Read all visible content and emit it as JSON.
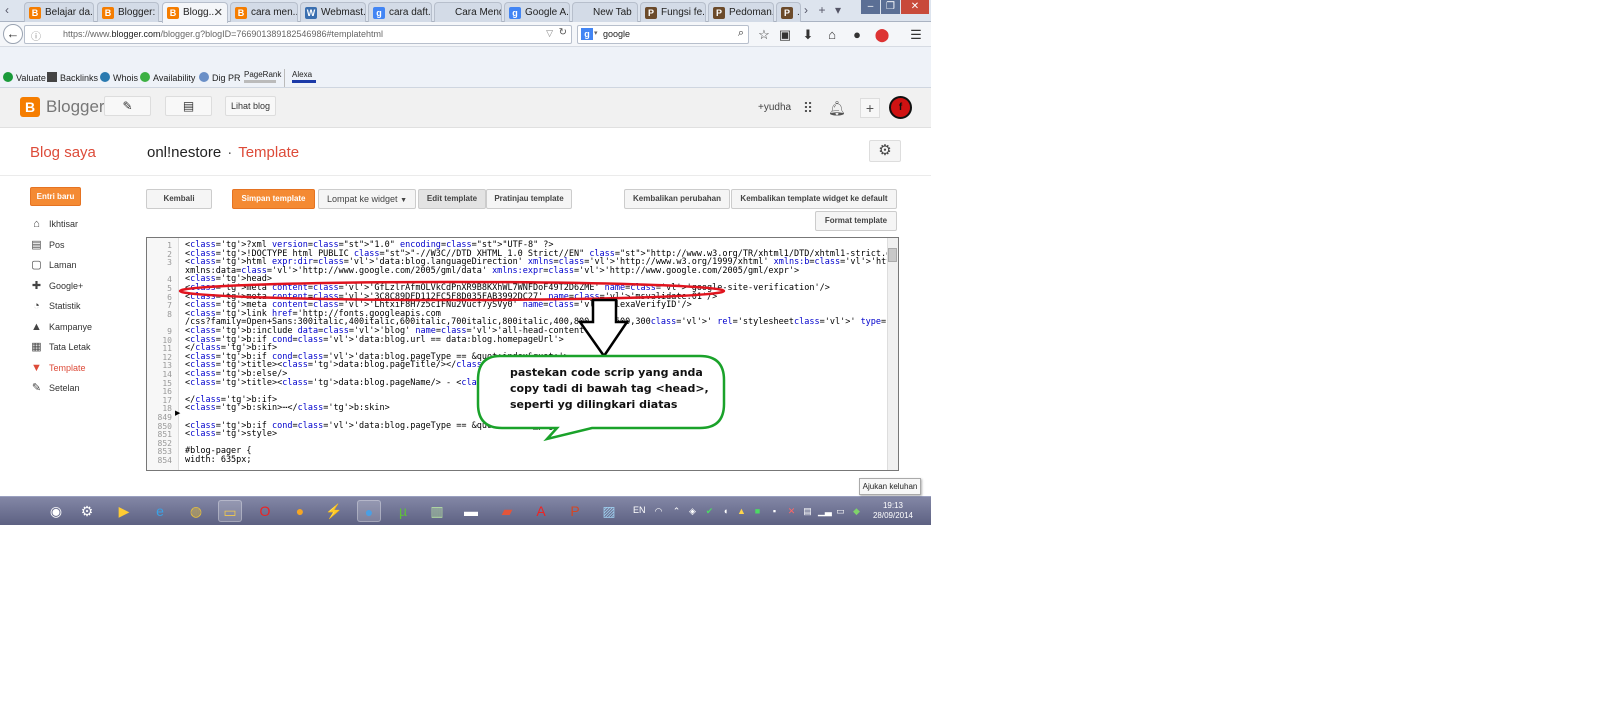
{
  "browser": {
    "tabs": [
      {
        "label": "Belajar da...",
        "icon": "blogger-icon",
        "color": "#f57d00",
        "glyph": "B"
      },
      {
        "label": "Blogger: ...",
        "icon": "blogger-icon",
        "color": "#f57d00",
        "glyph": "B"
      },
      {
        "label": "Blogg...",
        "icon": "blogger-icon",
        "color": "#f57d00",
        "glyph": "B",
        "active": true
      },
      {
        "label": "cara men...",
        "icon": "blogger-icon",
        "color": "#f57d00",
        "glyph": "B"
      },
      {
        "label": "Webmast...",
        "icon": "webmaster-icon",
        "color": "#3a6fb0",
        "glyph": "W"
      },
      {
        "label": "cara daft...",
        "icon": "google-icon",
        "color": "#4285f4",
        "glyph": "g"
      },
      {
        "label": "Cara Mendaft...",
        "icon": "blank-icon",
        "color": "#d3dbe7",
        "glyph": ""
      },
      {
        "label": "Google A...",
        "icon": "google-icon",
        "color": "#4285f4",
        "glyph": "g"
      },
      {
        "label": "New Tab",
        "icon": "blank-icon",
        "color": "#d3dbe7",
        "glyph": ""
      },
      {
        "label": "Fungsi fe...",
        "icon": "person-icon",
        "color": "#6b4a2a",
        "glyph": "P"
      },
      {
        "label": "Pedoman...",
        "icon": "person-icon",
        "color": "#6b4a2a",
        "glyph": "P"
      },
      {
        "label": "...",
        "icon": "person-icon",
        "color": "#6b4a2a",
        "glyph": "P"
      }
    ],
    "url_prefix": "https://www.",
    "url_domain": "blogger.com",
    "url_rest": "/blogger.g?blogID=7669013891825469​86#templatehtml",
    "search_value": "google",
    "bookmarks": [
      "Valuate",
      "Backlinks",
      "Whois",
      "Availability",
      "Dig PR",
      "PageRank",
      "Alexa"
    ]
  },
  "header": {
    "brand": "Blogger",
    "view_blog": "Lihat blog",
    "user": "+yudha"
  },
  "page": {
    "blogs_link": "Blog saya",
    "blog_name": "onl!nestore",
    "separator": "·",
    "section": "Template"
  },
  "sidebar": {
    "new_post": "Entri baru",
    "items": [
      {
        "label": "Ikhtisar",
        "glyph": "⌂"
      },
      {
        "label": "Pos",
        "glyph": "▤"
      },
      {
        "label": "Laman",
        "glyph": "▢"
      },
      {
        "label": "Google+",
        "glyph": "✚"
      },
      {
        "label": "Statistik",
        "glyph": "◔"
      },
      {
        "label": "Kampanye",
        "glyph": "▲"
      },
      {
        "label": "Tata Letak",
        "glyph": "▦"
      },
      {
        "label": "Template",
        "glyph": "▼",
        "active": true
      },
      {
        "label": "Setelan",
        "glyph": "✎"
      }
    ]
  },
  "toolbar": {
    "back": "Kembali",
    "save": "Simpan template",
    "jump": "Lompat ke widget",
    "edit": "Edit template",
    "preview": "Pratinjau template",
    "revert": "Kembalikan perubahan",
    "revert_widgets": "Kembalikan template widget ke default",
    "format": "Format template"
  },
  "editor": {
    "line_numbers": [
      "1",
      "2",
      "3",
      "",
      "4",
      "5",
      "6",
      "7",
      "8",
      "",
      "9",
      "10",
      "11",
      "12",
      "13",
      "14",
      "15",
      "16",
      "17",
      "18",
      "849",
      "850",
      "851",
      "852",
      "853",
      "854"
    ],
    "lines": [
      "<?xml version=\"1.0\" encoding=\"UTF-8\" ?>",
      "<!DOCTYPE html PUBLIC \"-//W3C//DTD XHTML 1.0 Strict//EN\" \"http://www.w3.org/TR/xhtml1/DTD/xhtml1-strict.dtd\">",
      "<html expr:dir='data:blog.languageDirection' xmlns='http://www.w3.org/1999/xhtml' xmlns:b='http://www.google.com/2005/gml/b'",
      "xmlns:data='http://www.google.com/2005/gml/data' xmlns:expr='http://www.google.com/2005/gml/expr'>",
      "  <head>",
      "<meta content='GfLzlrAfmOLVkCdPnXR9B8KXhWL7WNFDoF49T2D6ZME' name='google-site-verification'/>",
      "<meta content='3C8C89DFD112FC5F8D035FAB3992DC27' name='msvalidate.01'/>",
      "<meta content='LhtxiF8H7z5cIFNu2Vucf7ySVy0' name='alexaVerifyID'/>",
      "<link href='http://fonts.googleapis.com",
      "/css?family=Open+Sans:300italic,400italic,600italic,700italic,800italic,400,800,700,600,300' rel='stylesheet' type='text/css'/>",
      "<b:include data='blog' name='all-head-content'/>",
      "<b:if cond='data:blog.url == data:blog.homepageUrl'>",
      "</b:if>",
      "<b:if cond='data:blog.pageType == &quot;index&quot;'>",
      "<title><data:blog.pageTitle/></title>",
      "<b:else/>",
      "<title><data:blog.pageName/> - <data:blog.title/></title>",
      "",
      "</b:if>",
      "<b:skin>⋯</b:skin>",
      "",
      "<b:if cond='data:blog.pageType == &quot;static_page&quot;'>",
      "<style>",
      "",
      "#blog-pager {",
      "width: 635px;"
    ]
  },
  "annotation": {
    "callout": "pastekan code scrip yang anda copy tadi di bawah tag <head>, seperti yg dilingkari diatas"
  },
  "taskbar": {
    "language": "EN",
    "time": "19:13",
    "date": "28/09/2014",
    "tooltip": "Ajukan keluhan"
  }
}
